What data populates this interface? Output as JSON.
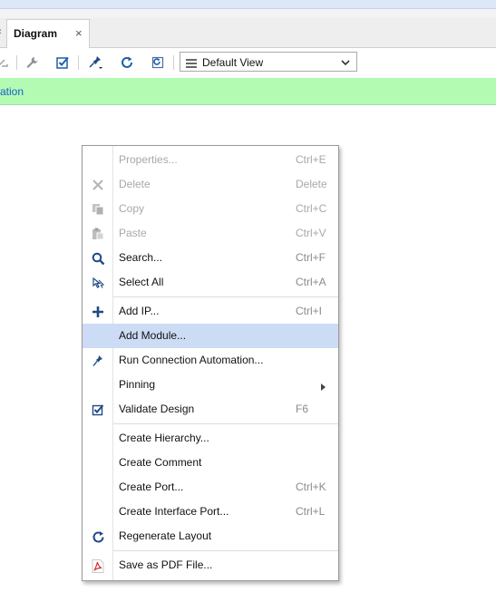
{
  "tab": {
    "label": "Diagram",
    "close": "×",
    "scroll_glyph": "‹"
  },
  "toolbar": {
    "view_select_value": "Default View"
  },
  "banner": {
    "link_text": "ation"
  },
  "menu": {
    "items": [
      {
        "label": "Properties...",
        "shortcut": "Ctrl+E",
        "icon": "",
        "disabled": true
      },
      {
        "label": "Delete",
        "shortcut": "Delete",
        "icon": "close-icon",
        "disabled": true
      },
      {
        "label": "Copy",
        "shortcut": "Ctrl+C",
        "icon": "copy-icon",
        "disabled": true
      },
      {
        "label": "Paste",
        "shortcut": "Ctrl+V",
        "icon": "paste-icon",
        "disabled": true
      },
      {
        "label": "Search...",
        "shortcut": "Ctrl+F",
        "icon": "search-icon",
        "disabled": false
      },
      {
        "label": "Select All",
        "shortcut": "Ctrl+A",
        "icon": "select-all-icon",
        "disabled": false
      },
      {
        "label": "Add IP...",
        "shortcut": "Ctrl+I",
        "icon": "add-icon",
        "disabled": false
      },
      {
        "label": "Add Module...",
        "shortcut": "",
        "icon": "",
        "disabled": false,
        "highlighted": true
      },
      {
        "label": "Run Connection Automation...",
        "shortcut": "",
        "icon": "connection-automation-icon",
        "disabled": false
      },
      {
        "label": "Pinning",
        "shortcut": "",
        "icon": "",
        "disabled": false,
        "submenu": true
      },
      {
        "label": "Validate Design",
        "shortcut": "F6",
        "icon": "validate-icon",
        "disabled": false
      },
      {
        "label": "Create Hierarchy...",
        "shortcut": "",
        "icon": "",
        "disabled": false
      },
      {
        "label": "Create Comment",
        "shortcut": "",
        "icon": "",
        "disabled": false
      },
      {
        "label": "Create Port...",
        "shortcut": "Ctrl+K",
        "icon": "",
        "disabled": false
      },
      {
        "label": "Create Interface Port...",
        "shortcut": "Ctrl+L",
        "icon": "",
        "disabled": false
      },
      {
        "label": "Regenerate Layout",
        "shortcut": "",
        "icon": "refresh-icon",
        "disabled": false
      },
      {
        "label": "Save as PDF File...",
        "shortcut": "",
        "icon": "pdf-icon",
        "disabled": false
      }
    ]
  },
  "colors": {
    "banner_bg": "#b3fbb3",
    "highlight_bg": "#cddcf5",
    "accent_blue": "#1f5fa8",
    "link_blue": "#1a5fc4"
  }
}
